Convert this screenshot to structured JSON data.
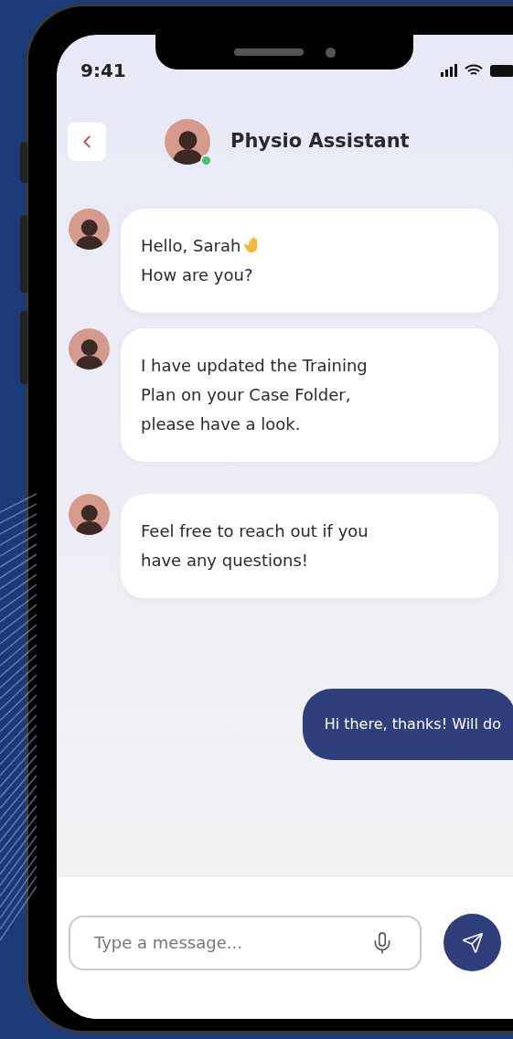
{
  "status_bar": {
    "time": "9:41"
  },
  "header": {
    "title": "Physio Assistant",
    "online": true
  },
  "messages": [
    {
      "kind": "received",
      "lines": [
        "Hello, Sarah",
        "How are you?"
      ],
      "wave": true
    },
    {
      "kind": "received",
      "lines": [
        "I have updated the Training",
        "Plan on your Case Folder,",
        "please have a look."
      ]
    },
    {
      "kind": "received",
      "lines": [
        "Feel free to reach out if you",
        "have any questions!"
      ]
    },
    {
      "kind": "sent",
      "lines": [
        "Hi there, thanks! Will do"
      ]
    }
  ],
  "composer": {
    "placeholder": "Type a message..."
  }
}
